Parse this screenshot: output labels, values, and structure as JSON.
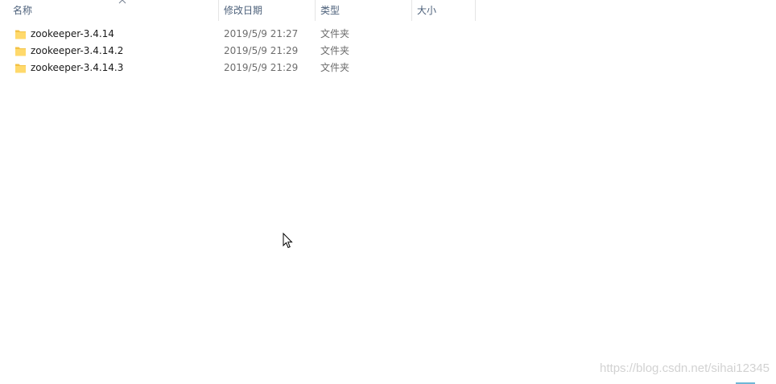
{
  "columns": {
    "name": "名称",
    "date": "修改日期",
    "type": "类型",
    "size": "大小"
  },
  "files": [
    {
      "name": "zookeeper-3.4.14",
      "date": "2019/5/9 21:27",
      "type": "文件夹",
      "icon": "folder-icon"
    },
    {
      "name": "zookeeper-3.4.14.2",
      "date": "2019/5/9 21:29",
      "type": "文件夹",
      "icon": "folder-icon"
    },
    {
      "name": "zookeeper-3.4.14.3",
      "date": "2019/5/9 21:29",
      "type": "文件夹",
      "icon": "folder-icon"
    }
  ],
  "watermark": "https://blog.csdn.net/sihai12345",
  "colors": {
    "header_text": "#4c607a",
    "folder_fill": "#ffd96b",
    "folder_back": "#f3c246",
    "accent_line": "#6fb7d6"
  }
}
